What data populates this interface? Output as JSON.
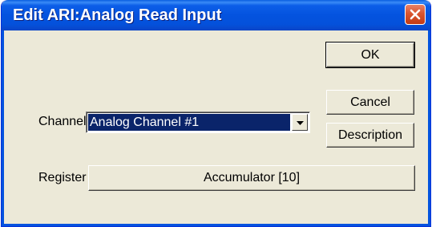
{
  "window": {
    "title": "Edit ARI:Analog Read Input"
  },
  "icons": {
    "close": "close-icon",
    "dropdown": "chevron-down-icon"
  },
  "colors": {
    "titlebar": "#0453df",
    "close": "#d9552f",
    "selection": "#0a246a",
    "face": "#ece9d8"
  },
  "form": {
    "channel_label": "Channel",
    "channel_value": "Analog Channel #1",
    "register_label": "Register",
    "register_value": "Accumulator [10]"
  },
  "buttons": {
    "ok": "OK",
    "cancel": "Cancel",
    "description": "Description"
  }
}
